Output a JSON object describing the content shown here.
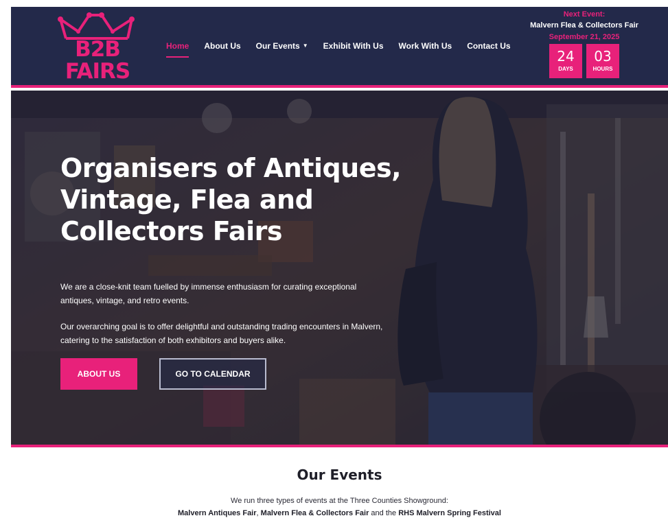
{
  "logo": {
    "line1": "B2B",
    "line2": "FAIRS"
  },
  "nav": {
    "items": [
      {
        "label": "Home"
      },
      {
        "label": "About Us"
      },
      {
        "label": "Our Events"
      },
      {
        "label": "Exhibit With Us"
      },
      {
        "label": "Work With Us"
      },
      {
        "label": "Contact Us"
      }
    ]
  },
  "next_event": {
    "label": "Next Event:",
    "name": "Malvern Flea & Collectors Fair",
    "date": "September 21, 2025",
    "days_value": "24",
    "days_unit": "DAYS",
    "hours_value": "03",
    "hours_unit": "HOURS"
  },
  "hero": {
    "title": "Organisers of Antiques, Vintage, Flea and Collectors Fairs",
    "paragraph1": "We are a close-knit team fuelled by immense enthusiasm for curating exceptional antiques, vintage, and retro events.",
    "paragraph2": "Our overarching goal is to offer delightful and outstanding trading encounters in Malvern, catering to the satisfaction of both exhibitors and buyers alike.",
    "btn_about": "ABOUT US",
    "btn_calendar": "GO TO CALENDAR"
  },
  "events": {
    "title": "Our Events",
    "intro": "We run three types of events at the Three Counties Showground:",
    "event1": "Malvern Antiques Fair",
    "sep1": ", ",
    "event2": "Malvern Flea & Collectors Fair",
    "sep2": " and the ",
    "event3": "RHS Malvern Spring Festival"
  },
  "colors": {
    "navy": "#23294a",
    "pink": "#e8217a",
    "white": "#ffffff"
  }
}
